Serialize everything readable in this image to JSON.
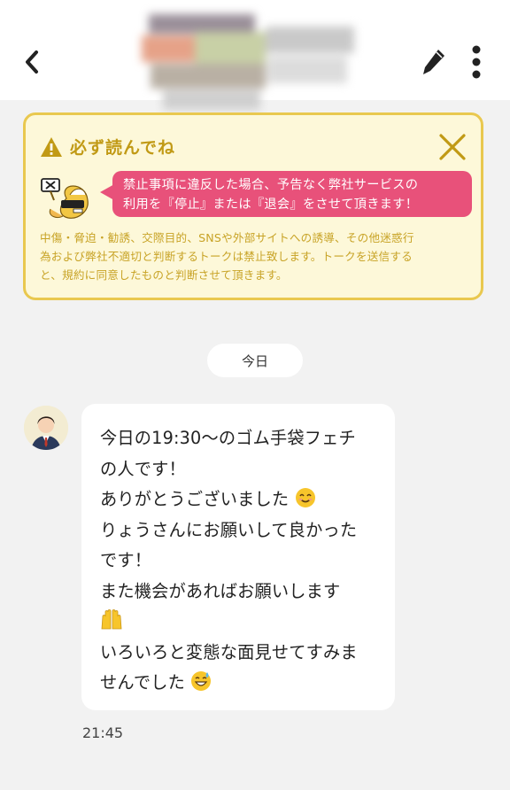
{
  "header": {
    "back_label": "back",
    "edit_label": "edit",
    "more_label": "more"
  },
  "notice": {
    "title": "必ず読んでね",
    "bubble_line1": "禁止事項に違反した場合、予告なく弊社サービスの",
    "bubble_line2": "利用を『停止』または『退会』をさせて頂きます！",
    "body_line1": "中傷・脅迫・勧誘、交際目的、SNSや外部サイトへの誘導、その他迷惑行",
    "body_line2": "為および弊社不適切と判断するトークは禁止致します。トークを送信する",
    "body_line3": "と、規約に同意したものと判断させて頂きます。",
    "accent_color": "#e9c84f",
    "bubble_color": "#e8517a"
  },
  "chat": {
    "date_label": "今日",
    "message": {
      "line1": "今日の19:30〜のゴム手袋フェチ",
      "line2": "の人です！",
      "line3": "ありがとうございました",
      "line4": "りょうさんにお願いして良かった",
      "line5": "です！",
      "line6": "また機会があればお願いします",
      "line7": "いろいろと変態な面見せてすみま",
      "line8": "せんでした",
      "emoji_smile": "smiling-face-icon",
      "emoji_hands": "raised-hands-icon",
      "emoji_sweat": "sweat-smile-icon"
    },
    "time": "21:45"
  }
}
